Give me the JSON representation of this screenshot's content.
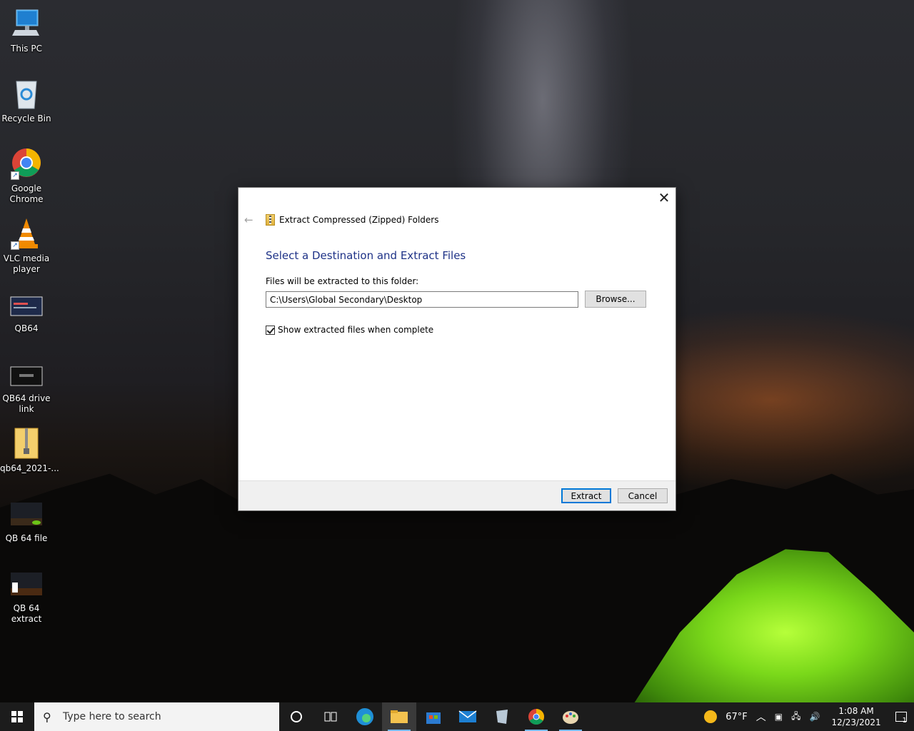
{
  "desktop": {
    "icons": [
      {
        "label": "This PC",
        "icon": "computer-icon"
      },
      {
        "label": "Recycle Bin",
        "icon": "recycle-bin-icon"
      },
      {
        "label": "Google Chrome",
        "icon": "chrome-icon"
      },
      {
        "label": "VLC media player",
        "icon": "vlc-icon"
      },
      {
        "label": "QB64",
        "icon": "qb64-icon"
      },
      {
        "label": "QB64 drive link",
        "icon": "image-file-icon"
      },
      {
        "label": "qb64_2021-...",
        "icon": "zip-folder-icon"
      },
      {
        "label": "QB 64 file",
        "icon": "image-file-icon"
      },
      {
        "label": "QB 64 extract",
        "icon": "image-file-icon"
      }
    ]
  },
  "dialog": {
    "close_glyph": "✕",
    "back_glyph": "←",
    "wizard_title": "Extract Compressed (Zipped) Folders",
    "heading": "Select a Destination and Extract Files",
    "folder_label": "Files will be extracted to this folder:",
    "destination_path": "C:\\Users\\Global Secondary\\Desktop",
    "browse_label": "Browse...",
    "show_files_label": "Show extracted files when complete",
    "show_files_checked": true,
    "extract_label": "Extract",
    "cancel_label": "Cancel"
  },
  "taskbar": {
    "search_placeholder": "Type here to search",
    "apps": [
      "cortana-icon",
      "task-view-icon",
      "edge-icon",
      "file-explorer-icon",
      "store-icon",
      "mail-icon",
      "app-icon",
      "chrome-icon",
      "paint-icon"
    ],
    "weather": "67°F",
    "time": "1:08 AM",
    "date": "12/23/2021",
    "notifications": "1"
  },
  "colors": {
    "heading": "#1e3287",
    "accent": "#0078d7",
    "taskbar": "#1c1c1c"
  }
}
